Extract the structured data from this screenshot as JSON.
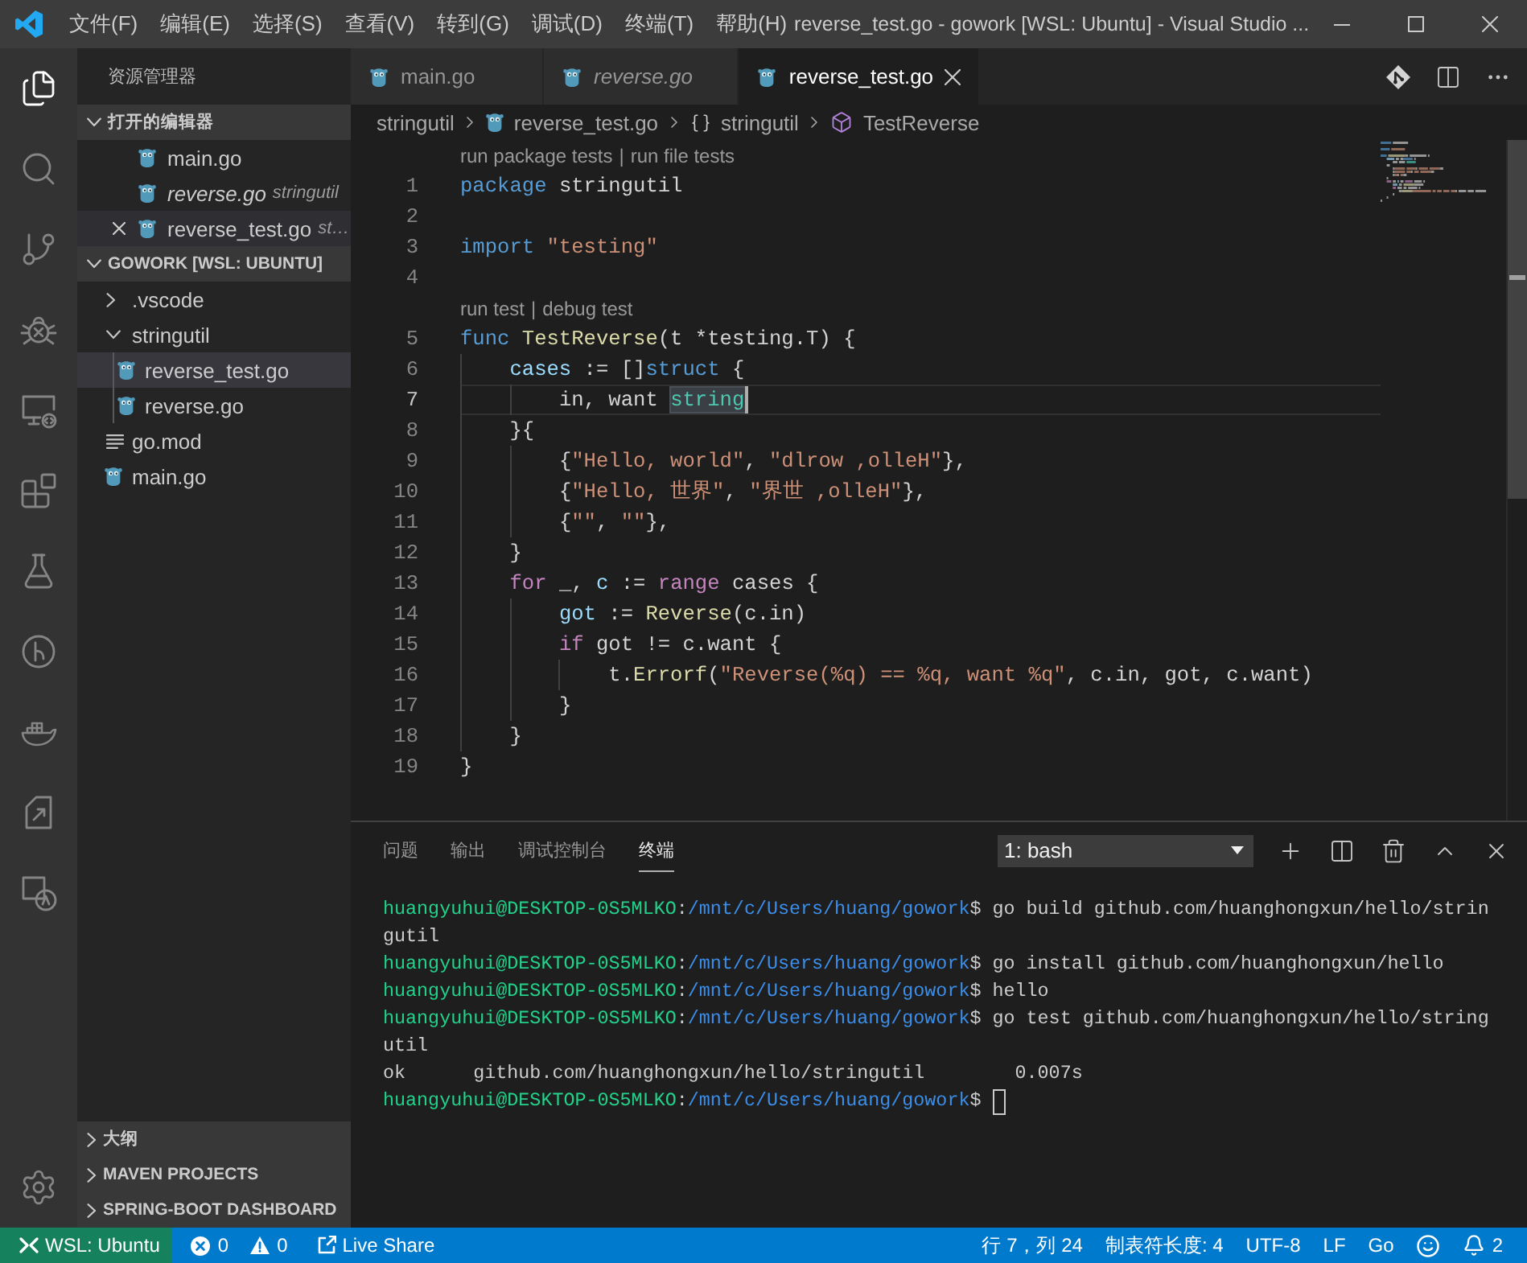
{
  "window": {
    "title": "reverse_test.go - gowork [WSL: Ubuntu] - Visual Studio ..."
  },
  "menu": [
    "文件(F)",
    "编辑(E)",
    "选择(S)",
    "查看(V)",
    "转到(G)",
    "调试(D)",
    "终端(T)",
    "帮助(H)"
  ],
  "activity_bar": {
    "items": [
      {
        "kind": "explorer",
        "selected": true
      },
      {
        "kind": "search",
        "selected": false
      },
      {
        "kind": "source-control",
        "selected": false
      },
      {
        "kind": "debug",
        "selected": false
      },
      {
        "kind": "remote",
        "selected": false
      },
      {
        "kind": "extensions",
        "selected": false
      },
      {
        "kind": "test",
        "selected": false
      },
      {
        "kind": "circle",
        "selected": false
      },
      {
        "kind": "docker",
        "selected": false
      },
      {
        "kind": "deploy",
        "selected": false
      },
      {
        "kind": "translate",
        "selected": false
      }
    ]
  },
  "sidebar": {
    "title": "资源管理器",
    "sections": [
      {
        "kind": "open-editors",
        "title": "打开的编辑器",
        "expanded": true,
        "items": [
          {
            "name": "main.go",
            "preview": false,
            "hovered": false
          },
          {
            "name": "reverse.go",
            "description": "stringutil",
            "preview": true,
            "hovered": false
          },
          {
            "name": "reverse_test.go",
            "description": "st…",
            "preview": false,
            "hovered": true
          }
        ]
      },
      {
        "kind": "folder",
        "title": "GOWORK [WSL: UBUNTU]",
        "expanded": true,
        "items": [
          {
            "kind": "folder",
            "name": ".vscode",
            "expanded": false,
            "selected": false
          },
          {
            "kind": "folder",
            "name": "stringutil",
            "expanded": true,
            "selected": false,
            "children": [
              {
                "kind": "go",
                "name": "reverse_test.go",
                "selected": true
              },
              {
                "kind": "go",
                "name": "reverse.go",
                "selected": false
              }
            ]
          },
          {
            "kind": "text",
            "name": "go.mod",
            "selected": false
          },
          {
            "kind": "go",
            "name": "main.go",
            "selected": false
          }
        ]
      },
      {
        "title": "大纲",
        "expanded": false
      },
      {
        "title": "MAVEN PROJECTS",
        "expanded": false
      },
      {
        "title": "SPRING-BOOT DASHBOARD",
        "expanded": false
      }
    ]
  },
  "editor": {
    "tabs": [
      {
        "label": "main.go",
        "preview": false,
        "selected": false
      },
      {
        "label": "reverse.go",
        "preview": true,
        "selected": false
      },
      {
        "label": "reverse_test.go",
        "preview": false,
        "selected": true
      }
    ],
    "breadcrumbs": [
      {
        "kind": "folder",
        "label": "stringutil"
      },
      {
        "kind": "go-file",
        "label": "reverse_test.go"
      },
      {
        "kind": "package",
        "label": "stringutil"
      },
      {
        "kind": "function",
        "label": "TestReverse"
      }
    ],
    "rows": [
      {
        "kind": "codelens",
        "actions": [
          "run package tests",
          "run file tests"
        ],
        "separator": "|"
      },
      {
        "kind": "code",
        "number": "1",
        "current": false,
        "tokens": [
          {
            "kind": "keyword",
            "text": "package"
          },
          {
            "kind": "plain",
            "text": " stringutil"
          }
        ]
      },
      {
        "kind": "code",
        "number": "2",
        "current": false
      },
      {
        "kind": "code",
        "number": "3",
        "current": false,
        "tokens": [
          {
            "kind": "keyword",
            "text": "import"
          },
          {
            "kind": "string",
            "text": " \"testing\""
          }
        ]
      },
      {
        "kind": "code",
        "number": "4",
        "current": false
      },
      {
        "kind": "codelens",
        "actions": [
          "run test",
          "debug test"
        ],
        "separator": "|"
      },
      {
        "kind": "code",
        "number": "5",
        "current": false,
        "tokens": [
          {
            "kind": "keyword",
            "text": "func"
          },
          {
            "kind": "function",
            "text": " TestReverse"
          },
          {
            "kind": "plain",
            "text": "(t *testing.T) {"
          }
        ]
      },
      {
        "kind": "code",
        "number": "6",
        "current": false,
        "tokens": [
          {
            "kind": "variable",
            "text": "    cases"
          },
          {
            "kind": "plain",
            "text": " := []"
          },
          {
            "kind": "keyword",
            "text": "struct"
          },
          {
            "kind": "plain",
            "text": " {"
          }
        ]
      },
      {
        "kind": "code",
        "number": "7",
        "current": true,
        "tokens": [
          {
            "kind": "plain",
            "text": "        in, want "
          },
          {
            "kind": "type",
            "text": "string"
          }
        ]
      },
      {
        "kind": "code",
        "number": "8",
        "current": false,
        "tokens": [
          {
            "kind": "plain",
            "text": "    }{"
          }
        ]
      },
      {
        "kind": "code",
        "number": "9",
        "current": false,
        "tokens": [
          {
            "kind": "plain",
            "text": "        {"
          },
          {
            "kind": "string",
            "text": "\"Hello, world\""
          },
          {
            "kind": "plain",
            "text": ", "
          },
          {
            "kind": "string",
            "text": "\"dlrow ,olleH\""
          },
          {
            "kind": "plain",
            "text": "},"
          }
        ]
      },
      {
        "kind": "code",
        "number": "10",
        "current": false,
        "tokens": [
          {
            "kind": "plain",
            "text": "        {"
          },
          {
            "kind": "string",
            "text": "\"Hello, 世界\""
          },
          {
            "kind": "plain",
            "text": ", "
          },
          {
            "kind": "string",
            "text": "\"界世 ,olleH\""
          },
          {
            "kind": "plain",
            "text": "},"
          }
        ]
      },
      {
        "kind": "code",
        "number": "11",
        "current": false,
        "tokens": [
          {
            "kind": "plain",
            "text": "        {"
          },
          {
            "kind": "string",
            "text": "\"\""
          },
          {
            "kind": "plain",
            "text": ", "
          },
          {
            "kind": "string",
            "text": "\"\""
          },
          {
            "kind": "plain",
            "text": "},"
          }
        ]
      },
      {
        "kind": "code",
        "number": "12",
        "current": false,
        "tokens": [
          {
            "kind": "plain",
            "text": "    }"
          }
        ]
      },
      {
        "kind": "code",
        "number": "13",
        "current": false,
        "tokens": [
          {
            "kind": "control",
            "text": "    for"
          },
          {
            "kind": "plain",
            "text": " _, "
          },
          {
            "kind": "variable",
            "text": "c"
          },
          {
            "kind": "plain",
            "text": " := "
          },
          {
            "kind": "control",
            "text": "range"
          },
          {
            "kind": "plain",
            "text": " cases {"
          }
        ]
      },
      {
        "kind": "code",
        "number": "14",
        "current": false,
        "tokens": [
          {
            "kind": "variable",
            "text": "        got"
          },
          {
            "kind": "plain",
            "text": " := "
          },
          {
            "kind": "function",
            "text": "Reverse"
          },
          {
            "kind": "plain",
            "text": "(c.in)"
          }
        ]
      },
      {
        "kind": "code",
        "number": "15",
        "current": false,
        "tokens": [
          {
            "kind": "control",
            "text": "        if"
          },
          {
            "kind": "plain",
            "text": " got != c.want {"
          }
        ]
      },
      {
        "kind": "code",
        "number": "16",
        "current": false,
        "tokens": [
          {
            "kind": "plain",
            "text": "            t."
          },
          {
            "kind": "function",
            "text": "Errorf"
          },
          {
            "kind": "plain",
            "text": "("
          },
          {
            "kind": "string",
            "text": "\"Reverse(%q) == %q, want %q\""
          },
          {
            "kind": "plain",
            "text": ", c.in, got, c.want)"
          }
        ]
      },
      {
        "kind": "code",
        "number": "17",
        "current": false,
        "tokens": [
          {
            "kind": "plain",
            "text": "        }"
          }
        ]
      },
      {
        "kind": "code",
        "number": "18",
        "current": false,
        "tokens": [
          {
            "kind": "plain",
            "text": "    }"
          }
        ]
      },
      {
        "kind": "code",
        "number": "19",
        "current": false,
        "tokens": [
          {
            "kind": "plain",
            "text": "}"
          }
        ]
      }
    ]
  },
  "panel": {
    "tabs": [
      {
        "label": "问题",
        "selected": false
      },
      {
        "label": "输出",
        "selected": false
      },
      {
        "label": "调试控制台",
        "selected": false
      },
      {
        "label": "终端",
        "selected": true
      }
    ],
    "terminal_picker": "1: bash",
    "terminal": {
      "cursor": true,
      "lines": [
        {
          "kind": "prompt",
          "user": "huangyuhui@DESKTOP-0S5MLKO",
          "separator": ":",
          "path": "/mnt/c/Users/huang/gowork",
          "symbol": "$",
          "command": "go build github.com/huanghongxun/hello/strin"
        },
        {
          "kind": "output",
          "text": "gutil"
        },
        {
          "kind": "prompt",
          "user": "huangyuhui@DESKTOP-0S5MLKO",
          "separator": ":",
          "path": "/mnt/c/Users/huang/gowork",
          "symbol": "$",
          "command": "go install github.com/huanghongxun/hello"
        },
        {
          "kind": "prompt",
          "user": "huangyuhui@DESKTOP-0S5MLKO",
          "separator": ":",
          "path": "/mnt/c/Users/huang/gowork",
          "symbol": "$",
          "command": "hello"
        },
        {
          "kind": "prompt",
          "user": "huangyuhui@DESKTOP-0S5MLKO",
          "separator": ":",
          "path": "/mnt/c/Users/huang/gowork",
          "symbol": "$",
          "command": "go test github.com/huanghongxun/hello/string"
        },
        {
          "kind": "output",
          "text": "util"
        },
        {
          "kind": "output",
          "text": "ok      github.com/huanghongxun/hello/stringutil        0.007s"
        },
        {
          "kind": "prompt",
          "user": "huangyuhui@DESKTOP-0S5MLKO",
          "separator": ":",
          "path": "/mnt/c/Users/huang/gowork",
          "symbol": "$"
        }
      ]
    }
  },
  "status_bar": {
    "remote": "WSL: Ubuntu",
    "errors": "0",
    "warnings": "0",
    "live_share": "Live Share",
    "position": "行 7，列 24",
    "tab_size": "制表符长度: 4",
    "encoding": "UTF-8",
    "line_ending": "LF",
    "language": "Go",
    "notifications": "2"
  }
}
